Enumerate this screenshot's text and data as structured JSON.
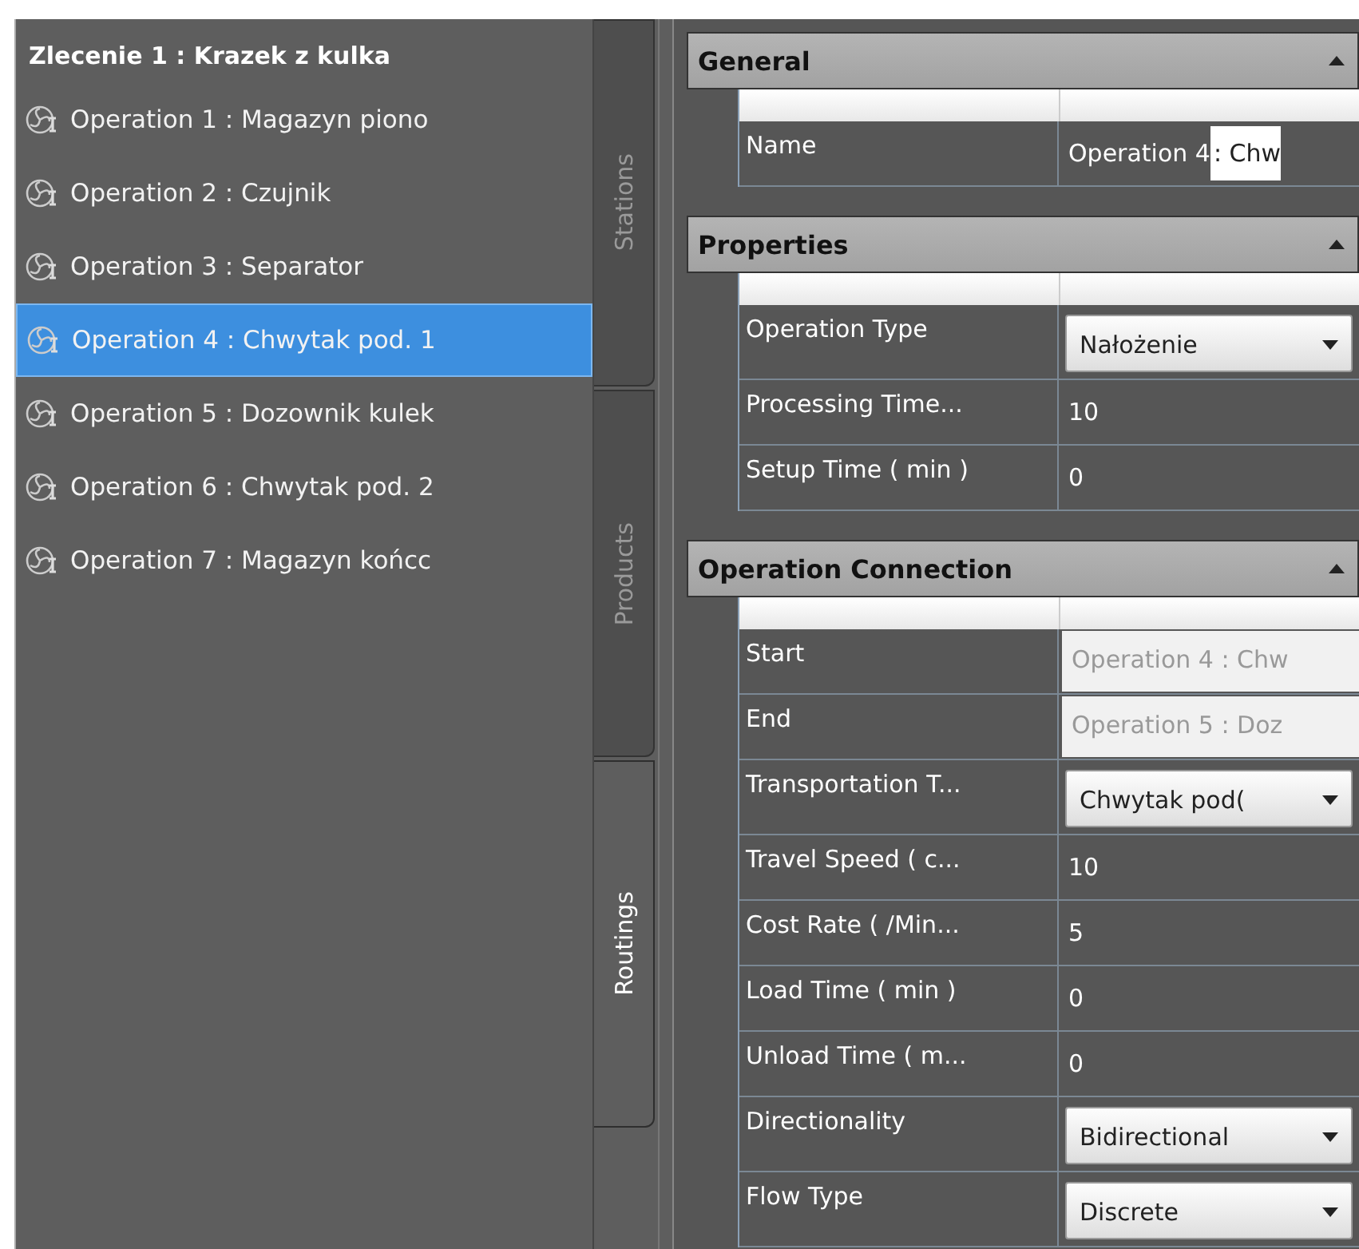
{
  "order": {
    "title": "Zlecenie 1 : Krazek z kulka",
    "operations": [
      {
        "label": "Operation 1 : Magazyn piono",
        "selected": false
      },
      {
        "label": "Operation 2 : Czujnik",
        "selected": false
      },
      {
        "label": "Operation 3 : Separator",
        "selected": false
      },
      {
        "label": "Operation 4 : Chwytak pod. 1",
        "selected": true
      },
      {
        "label": "Operation 5 : Dozownik kulek",
        "selected": false
      },
      {
        "label": "Operation 6 : Chwytak pod. 2",
        "selected": false
      },
      {
        "label": "Operation 7 : Magazyn końcc",
        "selected": false
      }
    ]
  },
  "side_tabs": [
    {
      "label": "Stations",
      "selected": false
    },
    {
      "label": "Products",
      "selected": false
    },
    {
      "label": "Routings",
      "selected": true
    }
  ],
  "sections": [
    {
      "title": "General",
      "expanded": true,
      "rows": [
        {
          "label": "Name",
          "kind": "edit",
          "value": "Operation 4",
          "selection": ": Chw"
        }
      ]
    },
    {
      "title": "Properties",
      "expanded": true,
      "rows": [
        {
          "label": "Operation Type",
          "kind": "dropdown",
          "value": "Nałożenie"
        },
        {
          "label": "Processing Time...",
          "kind": "text",
          "value": "10"
        },
        {
          "label": "Setup Time ( min )",
          "kind": "text",
          "value": "0"
        }
      ]
    },
    {
      "title": "Operation Connection",
      "expanded": true,
      "rows": [
        {
          "label": "Start",
          "kind": "readonly",
          "value": "Operation 4 : Chw"
        },
        {
          "label": "End",
          "kind": "readonly",
          "value": "Operation 5 : Doz"
        },
        {
          "label": "Transportation T...",
          "kind": "dropdown",
          "value": "Chwytak pod("
        },
        {
          "label": "Travel Speed ( c...",
          "kind": "text",
          "value": "10"
        },
        {
          "label": "Cost Rate ( /Min...",
          "kind": "text",
          "value": "5"
        },
        {
          "label": "Load Time ( min )",
          "kind": "text",
          "value": "0"
        },
        {
          "label": "Unload Time ( m...",
          "kind": "text",
          "value": "0"
        },
        {
          "label": "Directionality",
          "kind": "dropdown",
          "value": "Bidirectional"
        },
        {
          "label": "Flow Type",
          "kind": "dropdown",
          "value": "Discrete"
        }
      ]
    }
  ]
}
